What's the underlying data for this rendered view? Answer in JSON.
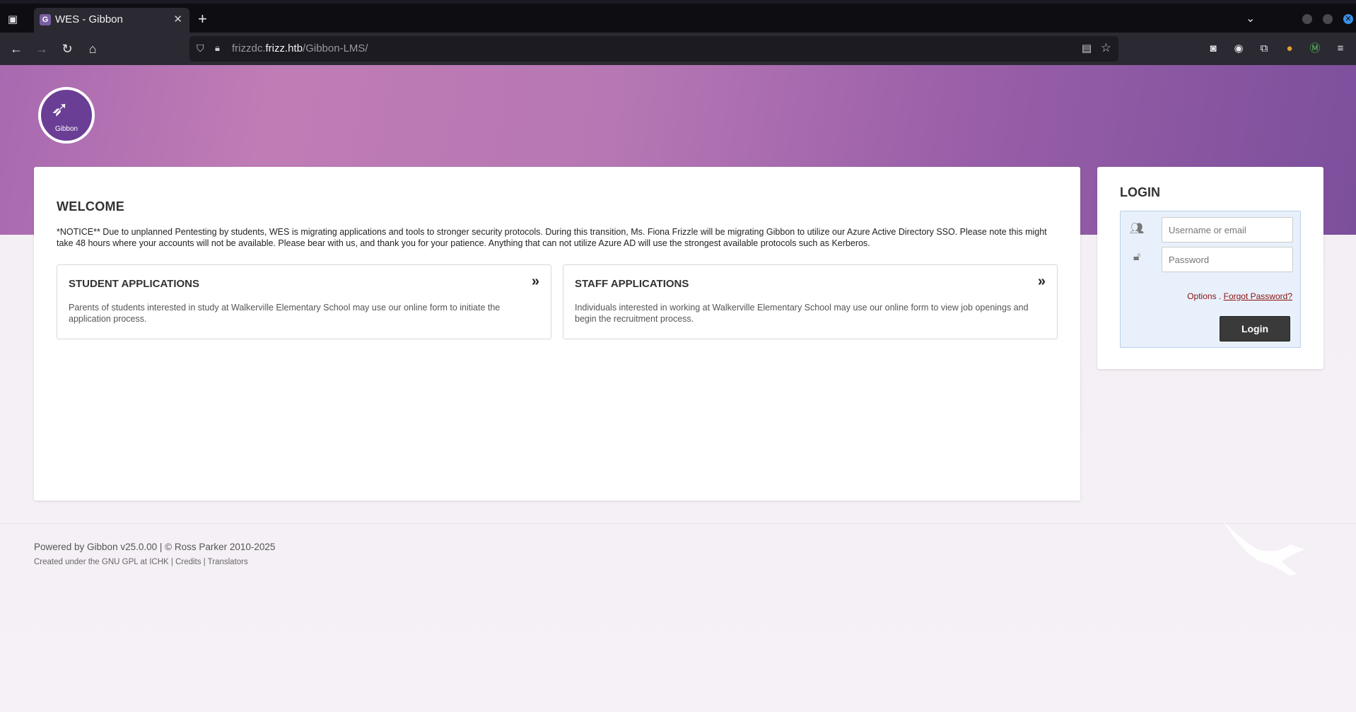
{
  "browser": {
    "tab_title": "WES - Gibbon",
    "favicon_letter": "G",
    "url_prefix": "frizzdc.",
    "url_host": "frizz.htb",
    "url_path": "/Gibbon-LMS/"
  },
  "header": {
    "logo_text": "Gibbon"
  },
  "welcome": {
    "title": "WELCOME",
    "notice": "*NOTICE** Due to unplanned Pentesting by students, WES is migrating applications and tools to stronger security protocols. During this transition, Ms. Fiona Frizzle will be migrating Gibbon to utilize our Azure Active Directory SSO. Please note this might take 48 hours where your accounts will not be available. Please bear with us, and thank you for your patience. Anything that can not utilize Azure AD will use the strongest available protocols such as Kerberos."
  },
  "applications": [
    {
      "title": "STUDENT APPLICATIONS",
      "description": "Parents of students interested in study at Walkerville Elementary School may use our online form to initiate the application process."
    },
    {
      "title": "STAFF APPLICATIONS",
      "description": "Individuals interested in working at Walkerville Elementary School may use our online form to view job openings and begin the recruitment process."
    }
  ],
  "login": {
    "title": "LOGIN",
    "username_placeholder": "Username or email",
    "password_placeholder": "Password",
    "options_label": "Options",
    "separator": ".",
    "forgot_label": "Forgot Password?",
    "button_label": "Login"
  },
  "footer": {
    "line1": "Powered by Gibbon v25.0.00 | © Ross Parker 2010-2025",
    "line2": "Created under the GNU GPL at ICHK | Credits | Translators"
  },
  "icons": {
    "back": "arrow-left-icon",
    "forward": "arrow-right-icon",
    "reload": "reload-icon",
    "home": "home-icon",
    "users": "users-icon",
    "lock": "lock-icon",
    "chevrons": "double-chevron-right-icon"
  }
}
